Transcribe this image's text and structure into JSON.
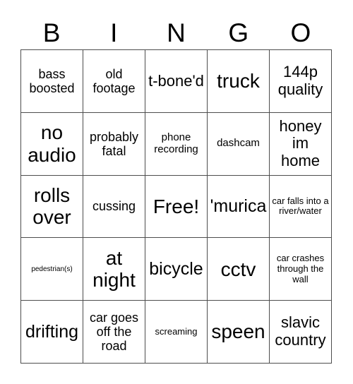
{
  "card": {
    "header_letters": [
      "B",
      "I",
      "N",
      "G",
      "O"
    ],
    "columns": 5,
    "rows": 5,
    "border_color": "#4d4d4d",
    "background_color": "#ffffff",
    "text_color": "#000000",
    "free_space_label": "Free!",
    "free_space_position": "row3-col3",
    "cells": [
      [
        {
          "text": "bass boosted",
          "size": "md"
        },
        {
          "text": "old footage",
          "size": "md"
        },
        {
          "text": "t-bone'd",
          "size": "lg"
        },
        {
          "text": "truck",
          "size": "xxl"
        },
        {
          "text": "144p quality",
          "size": "lg"
        }
      ],
      [
        {
          "text": "no audio",
          "size": "xxl"
        },
        {
          "text": "probably fatal",
          "size": "md"
        },
        {
          "text": "phone recording",
          "size": "sm"
        },
        {
          "text": "dashcam",
          "size": "sm"
        },
        {
          "text": "honey im home",
          "size": "lg"
        }
      ],
      [
        {
          "text": "rolls over",
          "size": "xxl"
        },
        {
          "text": "cussing",
          "size": "md"
        },
        {
          "text": "Free!",
          "size": "xxl"
        },
        {
          "text": "'murica",
          "size": "xl"
        },
        {
          "text": "car falls into a river/water",
          "size": "xs"
        }
      ],
      [
        {
          "text": "pedestrian(s)",
          "size": "xxs"
        },
        {
          "text": "at night",
          "size": "xxl"
        },
        {
          "text": "bicycle",
          "size": "xl"
        },
        {
          "text": "cctv",
          "size": "xxl"
        },
        {
          "text": "car crashes through the wall",
          "size": "xs"
        }
      ],
      [
        {
          "text": "drifting",
          "size": "xl"
        },
        {
          "text": "car goes off the road",
          "size": "md"
        },
        {
          "text": "screaming",
          "size": "xs"
        },
        {
          "text": "speen",
          "size": "xxl"
        },
        {
          "text": "slavic country",
          "size": "lg"
        }
      ]
    ]
  }
}
